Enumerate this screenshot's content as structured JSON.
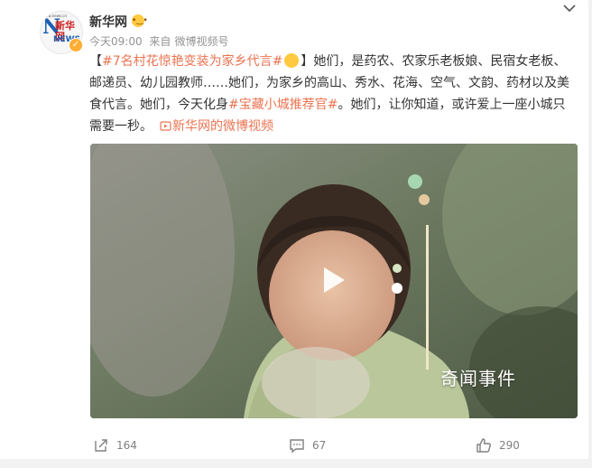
{
  "post": {
    "author": "新华网",
    "time": "今天09:00",
    "source_prefix": "来自",
    "source": "微博视频号",
    "text": {
      "open_bracket": "【",
      "topic1": "#7名村花惊艳变装为家乡代言#",
      "close_bracket": "】",
      "body1": "她们，是药农、农家乐老板娘、民宿女老板、邮递员、幼儿园教师……她们，为家乡的高山、秀水、花海、空气、文韵、药材以及美食代言。她们，今天化身",
      "topic2": "#宝藏小城推荐官#",
      "body2": "。她们，让你知道，或许爱上一座小城只需要一秒。",
      "video_link": "新华网的微博视频"
    }
  },
  "avatar_logo": {
    "mini": "www.news.cn",
    "cn": "新华网",
    "news": "NEWS"
  },
  "video": {
    "watermark": "奇闻事件"
  },
  "actions": {
    "repost": "164",
    "comment": "67",
    "like": "290"
  },
  "icons": [
    "chevron-down-icon",
    "verified-badge-icon",
    "play-icon",
    "repost-icon",
    "comment-icon",
    "like-icon"
  ],
  "colors": {
    "topic": "#eb7350",
    "meta": "#939393",
    "verified": "#ffad33"
  }
}
